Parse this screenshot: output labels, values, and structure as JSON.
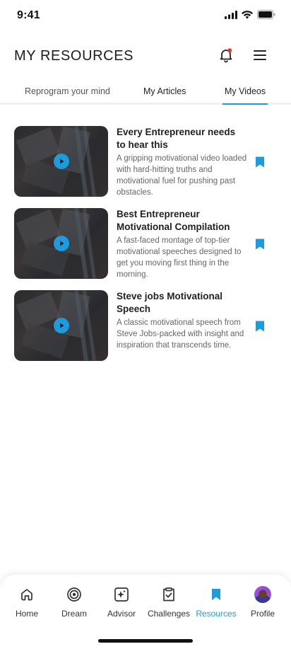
{
  "status_bar": {
    "time": "9:41"
  },
  "header": {
    "title": "MY RESOURCES"
  },
  "tabs": [
    {
      "label": "Reprogram your mind",
      "active": false
    },
    {
      "label": "My Articles",
      "active": false
    },
    {
      "label": "My Videos",
      "active": true
    }
  ],
  "videos": [
    {
      "title": "Every Entrepreneur needs to hear this",
      "description": "A gripping motivational video loaded with hard-hitting truths and motivational fuel for pushing past obstacles."
    },
    {
      "title": "Best Entrepreneur Motivational Compilation",
      "description": "A fast-faced montage of top-tier motivational speeches designed to get you moving first thing in the morning."
    },
    {
      "title": "Steve jobs Motivational Speech",
      "description": "A classic motivational speech from Steve Jobs-packed with insight and inspiration that transcends time."
    }
  ],
  "bottom_nav": [
    {
      "label": "Home",
      "icon": "home-icon"
    },
    {
      "label": "Dream",
      "icon": "target-icon"
    },
    {
      "label": "Advisor",
      "icon": "sparkle-icon"
    },
    {
      "label": "Challenges",
      "icon": "clipboard-check-icon"
    },
    {
      "label": "Resources",
      "icon": "bookmark-icon",
      "active": true
    },
    {
      "label": "Profile",
      "icon": "avatar"
    }
  ],
  "colors": {
    "accent": "#1d9bdc",
    "notification_dot": "#e53935"
  }
}
